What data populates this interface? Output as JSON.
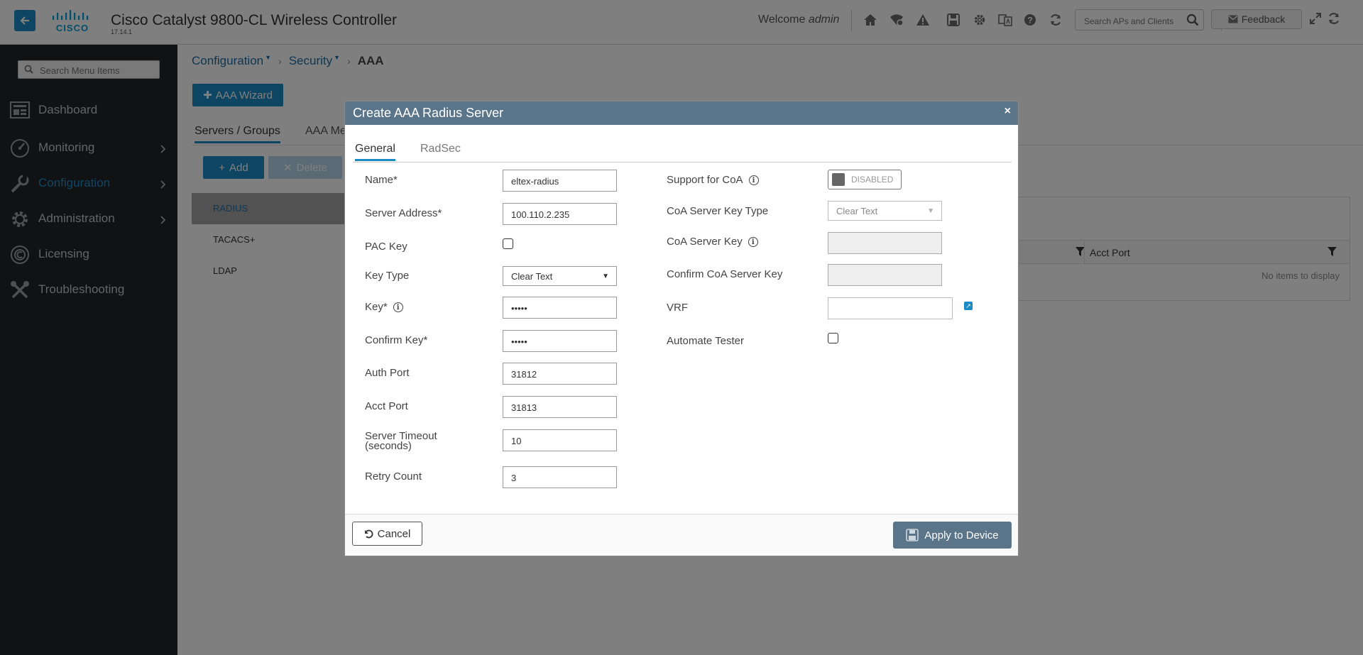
{
  "header": {
    "title": "Cisco Catalyst 9800-CL Wireless Controller",
    "version": "17.14.1",
    "logo_text": "CISCO",
    "welcome_prefix": "Welcome",
    "welcome_user": "admin",
    "search_placeholder": "Search APs and Clients",
    "feedback_label": "Feedback"
  },
  "sidebar": {
    "search_placeholder": "Search Menu Items",
    "items": [
      {
        "label": "Dashboard",
        "icon": "dashboard-icon"
      },
      {
        "label": "Monitoring",
        "icon": "monitoring-icon"
      },
      {
        "label": "Configuration",
        "icon": "configuration-icon",
        "active": true
      },
      {
        "label": "Administration",
        "icon": "administration-icon"
      },
      {
        "label": "Licensing",
        "icon": "licensing-icon"
      },
      {
        "label": "Troubleshooting",
        "icon": "troubleshooting-icon"
      }
    ]
  },
  "breadcrumb": {
    "items": [
      "Configuration",
      "Security",
      "AAA"
    ]
  },
  "page": {
    "wizard_label": "AAA Wizard",
    "tabs": [
      "Servers / Groups",
      "AAA Me"
    ],
    "add_label": "Add",
    "delete_label": "Delete",
    "server_types": [
      "RADIUS",
      "TACACS+",
      "LDAP"
    ],
    "grid_column": "Acct Port",
    "no_items_text": "No items to display"
  },
  "modal": {
    "title": "Create AAA Radius Server",
    "close": "×",
    "tabs": [
      "General",
      "RadSec"
    ],
    "left": {
      "name_label": "Name*",
      "name_value": "eltex-radius",
      "server_address_label": "Server Address*",
      "server_address_value": "100.110.2.235",
      "pac_key_label": "PAC Key",
      "key_type_label": "Key Type",
      "key_type_value": "Clear Text",
      "key_label": "Key*",
      "key_value": "•••••",
      "confirm_key_label": "Confirm Key*",
      "confirm_key_value": "•••••",
      "auth_port_label": "Auth Port",
      "auth_port_value": "31812",
      "acct_port_label": "Acct Port",
      "acct_port_value": "31813",
      "timeout_label_1": "Server Timeout",
      "timeout_label_2": "(seconds)",
      "timeout_value": "10",
      "retry_label": "Retry Count",
      "retry_value": "3"
    },
    "right": {
      "coa_label": "Support for CoA",
      "coa_toggle": "DISABLED",
      "coa_key_type_label": "CoA Server Key Type",
      "coa_key_type_value": "Clear Text",
      "coa_key_label": "CoA Server Key",
      "confirm_coa_key_label": "Confirm CoA Server Key",
      "vrf_label": "VRF",
      "automate_tester_label": "Automate Tester"
    },
    "cancel_label": "Cancel",
    "apply_label": "Apply to Device"
  }
}
